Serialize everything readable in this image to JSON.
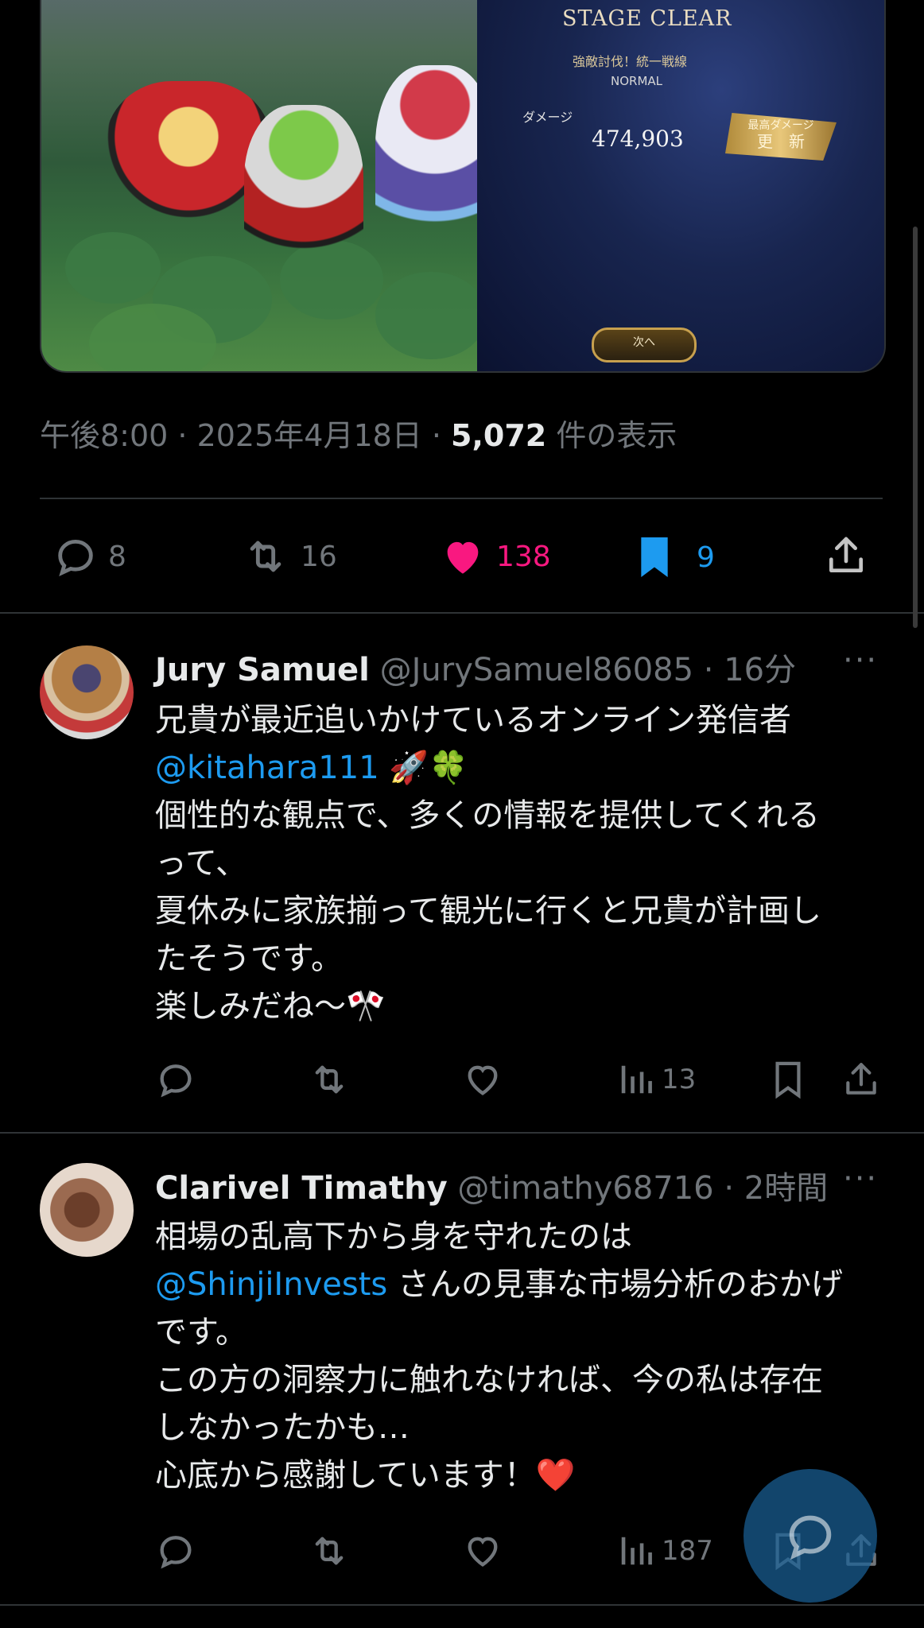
{
  "media": {
    "stage_clear": "STAGE CLEAR",
    "subtitle": "強敵討伐！統一戦線",
    "mode": "NORMAL",
    "damage_label": "ダメージ",
    "damage_value": "474,903",
    "best_label": "最高ダメージ",
    "best_update": "更　新",
    "next_button": "次へ"
  },
  "tweet": {
    "time": "午後8:00 · 2025年4月18日 · ",
    "views": "5,072",
    "views_suffix": " 件の表示",
    "replies": "8",
    "retweets": "16",
    "likes": "138",
    "bookmarks": "9",
    "colors": {
      "like": "#f91880",
      "bookmark": "#1d9bf0",
      "muted": "#71767b"
    }
  },
  "replies": [
    {
      "name": "Jury Samuel",
      "handle": "@JurySamuel86085 · 16分",
      "lines": [
        "兄貴が最近追いかけているオンライン発信者",
        "@kitahara111",
        " 🚀🍀",
        "個性的な観点で、多くの情報を提供してくれる",
        "って、",
        "夏休みに家族揃って観光に行くと兄貴が計画し",
        "たそうです。",
        "楽しみだね〜🎌"
      ],
      "views": "13"
    },
    {
      "name": "Clarivel Timathy",
      "handle": "@timathy68716 · 2時間",
      "lines": [
        "相場の乱高下から身を守れたのは",
        "@ShinjiInvests",
        " さんの見事な市場分析のおかげ",
        "です。",
        "この方の洞察力に触れなければ、今の私は存在",
        "しなかったかも…",
        "心底から感謝しています！❤️"
      ],
      "views": "187"
    }
  ],
  "more_label": "···"
}
